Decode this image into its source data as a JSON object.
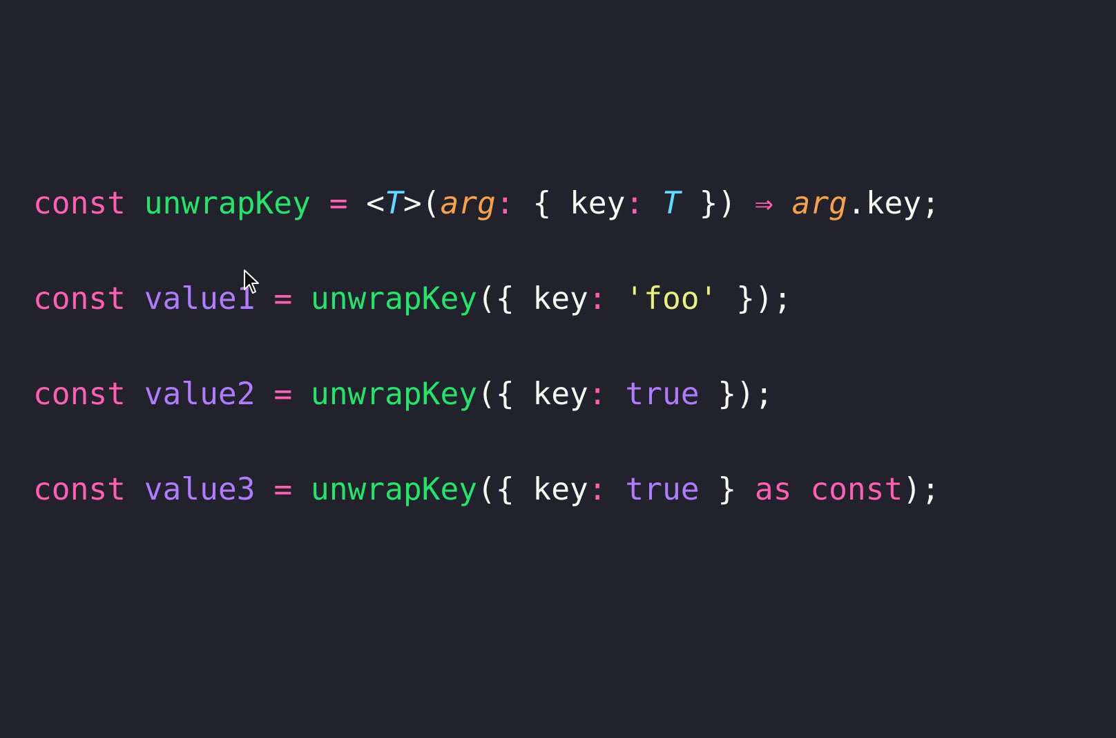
{
  "colors": {
    "background": "#22222d",
    "keyword": "#ff5fb0",
    "function": "#22e66a",
    "variable": "#b07cff",
    "parameter": "#f7a24a",
    "type": "#5fd9ff",
    "string": "#e9f27a",
    "boolean": "#b07cff",
    "plain": "#f8f8f2"
  },
  "code": {
    "lines": [
      [
        {
          "text": "const",
          "kind": "keyword"
        },
        {
          "text": " ",
          "kind": "plain"
        },
        {
          "text": "unwrapKey",
          "kind": "function"
        },
        {
          "text": " ",
          "kind": "plain"
        },
        {
          "text": "=",
          "kind": "keyword"
        },
        {
          "text": " <",
          "kind": "plain"
        },
        {
          "text": "T",
          "kind": "type",
          "italic": true
        },
        {
          "text": ">(",
          "kind": "plain"
        },
        {
          "text": "arg",
          "kind": "parameter",
          "italic": true
        },
        {
          "text": ":",
          "kind": "keyword"
        },
        {
          "text": " { key",
          "kind": "plain"
        },
        {
          "text": ":",
          "kind": "keyword"
        },
        {
          "text": " ",
          "kind": "plain"
        },
        {
          "text": "T",
          "kind": "type",
          "italic": true
        },
        {
          "text": " }) ",
          "kind": "plain"
        },
        {
          "text": "⇒",
          "kind": "keyword"
        },
        {
          "text": " ",
          "kind": "plain"
        },
        {
          "text": "arg",
          "kind": "parameter",
          "italic": true
        },
        {
          "text": ".key;",
          "kind": "plain"
        }
      ],
      [
        {
          "text": "const",
          "kind": "keyword"
        },
        {
          "text": " ",
          "kind": "plain"
        },
        {
          "text": "value1",
          "kind": "variable"
        },
        {
          "text": " ",
          "kind": "plain"
        },
        {
          "text": "=",
          "kind": "keyword"
        },
        {
          "text": " ",
          "kind": "plain"
        },
        {
          "text": "unwrapKey",
          "kind": "function"
        },
        {
          "text": "({ key",
          "kind": "plain"
        },
        {
          "text": ":",
          "kind": "keyword"
        },
        {
          "text": " ",
          "kind": "plain"
        },
        {
          "text": "'foo'",
          "kind": "string"
        },
        {
          "text": " });",
          "kind": "plain"
        }
      ],
      [
        {
          "text": "const",
          "kind": "keyword"
        },
        {
          "text": " ",
          "kind": "plain"
        },
        {
          "text": "value2",
          "kind": "variable"
        },
        {
          "text": " ",
          "kind": "plain"
        },
        {
          "text": "=",
          "kind": "keyword"
        },
        {
          "text": " ",
          "kind": "plain"
        },
        {
          "text": "unwrapKey",
          "kind": "function"
        },
        {
          "text": "({ key",
          "kind": "plain"
        },
        {
          "text": ":",
          "kind": "keyword"
        },
        {
          "text": " ",
          "kind": "plain"
        },
        {
          "text": "true",
          "kind": "boolean"
        },
        {
          "text": " });",
          "kind": "plain"
        }
      ],
      [
        {
          "text": "const",
          "kind": "keyword"
        },
        {
          "text": " ",
          "kind": "plain"
        },
        {
          "text": "value3",
          "kind": "variable"
        },
        {
          "text": " ",
          "kind": "plain"
        },
        {
          "text": "=",
          "kind": "keyword"
        },
        {
          "text": " ",
          "kind": "plain"
        },
        {
          "text": "unwrapKey",
          "kind": "function"
        },
        {
          "text": "({ key",
          "kind": "plain"
        },
        {
          "text": ":",
          "kind": "keyword"
        },
        {
          "text": " ",
          "kind": "plain"
        },
        {
          "text": "true",
          "kind": "boolean"
        },
        {
          "text": " } ",
          "kind": "plain"
        },
        {
          "text": "as",
          "kind": "keyword"
        },
        {
          "text": " ",
          "kind": "plain"
        },
        {
          "text": "const",
          "kind": "keyword"
        },
        {
          "text": ");",
          "kind": "plain"
        }
      ]
    ]
  },
  "pointer": {
    "icon": "mouse-pointer-icon"
  }
}
